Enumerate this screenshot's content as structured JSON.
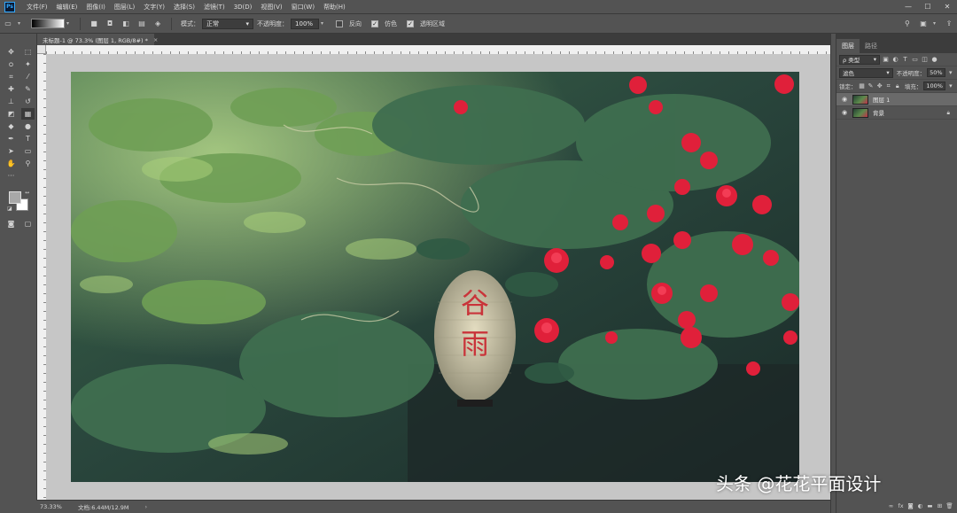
{
  "app": {
    "logo_text": "Ps"
  },
  "menu": {
    "items": [
      "文件(F)",
      "编辑(E)",
      "图像(I)",
      "图层(L)",
      "文字(Y)",
      "选择(S)",
      "滤镜(T)",
      "3D(D)",
      "视图(V)",
      "窗口(W)",
      "帮助(H)"
    ]
  },
  "window_controls": {
    "minimize": "—",
    "maximize": "☐",
    "close": "✕"
  },
  "options_bar": {
    "mode_label": "模式：",
    "mode_value": "正常",
    "opacity_label": "不透明度：",
    "opacity_value": "100%",
    "reverse_label": "反向",
    "dither_label": "仿色",
    "transparency_label": "透明区域",
    "reverse_checked": false,
    "dither_checked": true,
    "transparency_checked": true
  },
  "document": {
    "tab_title": "未标题-1 @ 73.3% (图层 1, RGB/8#) *",
    "close": "×"
  },
  "status": {
    "zoom": "73.33%",
    "doc_info": "文档:6.44M/12.9M",
    "arrow": "›"
  },
  "panels": {
    "tabs": [
      "图层",
      "路径"
    ],
    "filter_label": "ρ 类型",
    "blend_mode": "滤色",
    "opacity_label": "不透明度：",
    "opacity_value": "50%",
    "lock_label": "锁定：",
    "fill_label": "填充：",
    "fill_value": "100%",
    "layers": [
      {
        "name": "图层 1",
        "selected": true,
        "locked": false
      },
      {
        "name": "背景",
        "selected": false,
        "locked": true
      }
    ]
  },
  "canvas_content": {
    "lantern_text_top": "谷",
    "lantern_text_bottom": "雨"
  },
  "watermark": "头条 @花花平面设计",
  "colors": {
    "accent": "#31a8ff",
    "foreground": "#a8a8a8",
    "background": "#ffffff",
    "rose": "#e0203a"
  }
}
